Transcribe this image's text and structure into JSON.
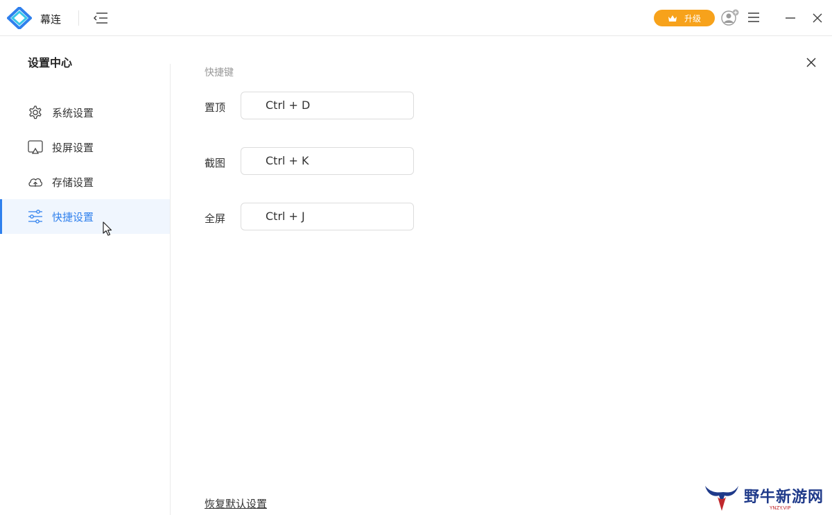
{
  "app": {
    "name": "幕连"
  },
  "header": {
    "upgrade_label": "升级"
  },
  "sidebar": {
    "title": "设置中心",
    "items": [
      {
        "label": "系统设置",
        "icon": "gear-icon"
      },
      {
        "label": "投屏设置",
        "icon": "cast-icon"
      },
      {
        "label": "存储设置",
        "icon": "cloud-icon"
      },
      {
        "label": "快捷设置",
        "icon": "sliders-icon",
        "active": true
      }
    ]
  },
  "main": {
    "section_title": "快捷键",
    "shortcuts": [
      {
        "label": "置顶",
        "value": "Ctrl + D"
      },
      {
        "label": "截图",
        "value": "Ctrl + K"
      },
      {
        "label": "全屏",
        "value": "Ctrl + J"
      }
    ],
    "restore_label": "恢复默认设置"
  },
  "watermark": {
    "text": "野牛新游网",
    "sub": "YNZY.VIP"
  },
  "colors": {
    "accent": "#2f80ed",
    "upgrade": "#f7a21b",
    "active_bg": "#f0f6fe"
  }
}
